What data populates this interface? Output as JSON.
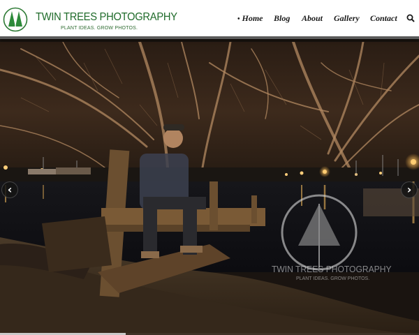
{
  "brand": {
    "title": "TWIN TREES PHOTOGRAPHY",
    "tagline": "PLANT IDEAS. GROW PHOTOS.",
    "logo_icon": "twin-trees-logo-icon",
    "color": "#1f6b2a"
  },
  "nav": {
    "items": [
      {
        "label": "Home",
        "active": true
      },
      {
        "label": "Blog"
      },
      {
        "label": "About"
      },
      {
        "label": "Gallery"
      },
      {
        "label": "Contact"
      }
    ],
    "active_marker": "•",
    "search_icon": "search-icon"
  },
  "slider": {
    "prev_icon": "chevron-left-icon",
    "next_icon": "chevron-right-icon",
    "prev_glyph": "‹",
    "next_glyph": "›",
    "progress": 0.3
  },
  "watermark": {
    "title": "TWIN TREES PHOTOGRAPHY",
    "tagline": "PLANT IDEAS. GROW PHOTOS."
  }
}
